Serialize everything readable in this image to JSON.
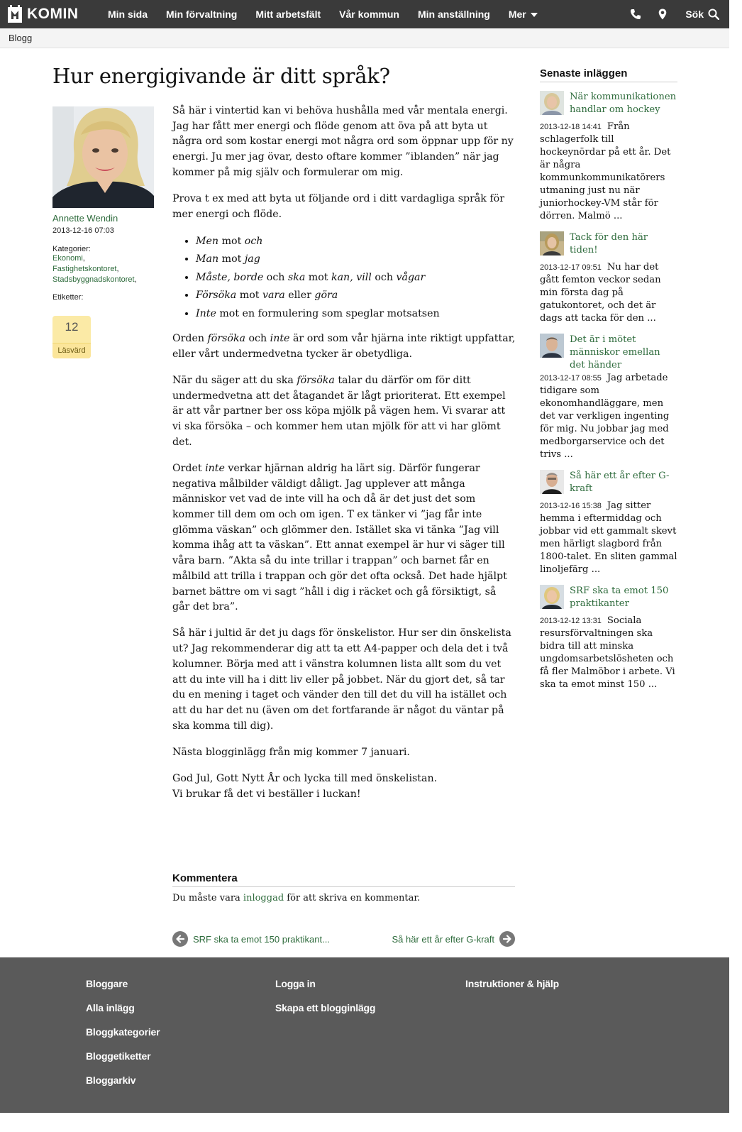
{
  "header": {
    "logo_text": "KOMIN",
    "nav": [
      "Min sida",
      "Min förvaltning",
      "Mitt arbetsfält",
      "Vår kommun",
      "Min anställning"
    ],
    "more_label": "Mer",
    "search_label": "Sök",
    "icons": [
      "phone-icon",
      "location-pin-icon",
      "search-icon"
    ]
  },
  "breadcrumb": "Blogg",
  "post": {
    "title": "Hur energigivande är ditt språk?",
    "author": "Annette Wendin",
    "date": "2013-12-16 07:03",
    "categories_label": "Kategorier:",
    "categories": [
      "Ekonomi",
      "Fastighetskontoret",
      "Stadsbyggnadskontoret"
    ],
    "tags_label": "Etiketter:",
    "worth_count": "12",
    "worth_label": "Läsvärd",
    "p1": "Så här i vintertid kan vi behöva hushålla med vår mentala energi. Jag har fått mer energi och flöde genom att öva på att byta ut några ord som kostar energi mot några ord som öppnar upp för ny energi. Ju mer jag övar, desto oftare kommer ”iblanden” när jag kommer på mig själv och formulerar om mig.",
    "p2": "Prova t ex med att byta ut följande ord i ditt vardagliga språk för mer energi och flöde.",
    "list": [
      {
        "a": "Men",
        "mid": " mot ",
        "b": "och",
        "c": "",
        "d": ""
      },
      {
        "a": "Man",
        "mid": " mot ",
        "b": "jag",
        "c": "",
        "d": ""
      },
      {
        "a": "Måste, borde",
        "mid": " och ",
        "b": "ska",
        "c": " mot ",
        "d": "kan, vill"
      },
      {
        "a": "Försöka",
        "mid": " mot ",
        "b": "vara",
        "c": " eller ",
        "d": "göra"
      },
      {
        "a": "Inte",
        "mid": " mot en formulering som speglar motsatsen",
        "b": "",
        "c": "",
        "d": ""
      }
    ],
    "list3_tail_mid": " och ",
    "list3_tail": "vågar",
    "p3_a": "Orden ",
    "p3_b": "försöka",
    "p3_c": " och ",
    "p3_d": "inte",
    "p3_e": " är ord som vår hjärna inte riktigt uppfattar, eller vårt undermedvetna tycker är obetydliga.",
    "p4_a": "När du säger att du ska ",
    "p4_b": "försöka",
    "p4_c": " talar du därför om för ditt undermedvetna att det åtagandet är lågt prioriterat. Ett exempel är att vår partner ber oss köpa mjölk på vägen hem. Vi svarar att vi ska försöka – och kommer hem utan mjölk för att vi har glömt det.",
    "p5_a": "Ordet ",
    "p5_b": "inte",
    "p5_c": " verkar hjärnan aldrig ha lärt sig. Därför fungerar negativa målbilder väldigt dåligt. Jag upplever att många människor vet vad de inte vill ha och då är det just det som kommer till dem om och om igen. T ex tänker vi ”jag får inte glömma väskan” och glömmer den. Istället ska vi tänka ”Jag vill komma ihåg att ta väskan”. Ett annat exempel är hur vi säger till våra barn. ”Akta så du inte trillar i trappan” och barnet får en målbild att trilla i trappan och gör det ofta också. Det hade hjälpt barnet bättre om vi sagt ”håll i dig i räcket och gå försiktigt, så går det bra”.",
    "p6": "Så här i jultid är det ju dags för önskelistor. Hur ser din önskelista ut? Jag rekommenderar dig att ta ett A4-papper och dela det i två kolumner. Börja med att i vänstra kolumnen lista allt som du vet att du inte vill ha i ditt liv eller på jobbet. När du gjort det, så tar du en mening i taget och vänder den till det du vill ha istället och att du har det nu (även om det fortfarande är något du väntar på ska komma till dig).",
    "p7": "Nästa blogginlägg  från mig kommer 7 januari.",
    "p8_1": "God Jul, Gott Nytt År och lycka till med önskelistan.",
    "p8_2": "Vi brukar få det vi beställer i luckan!"
  },
  "comment": {
    "heading": "Kommentera",
    "text_before": "Du måste vara ",
    "link": "inloggad",
    "text_after": " för att skriva en kommentar."
  },
  "pager": {
    "prev": "SRF ska ta emot 150 praktikant...",
    "next": "Så här ett år efter G-kraft"
  },
  "sidebar": {
    "heading": "Senaste inläggen",
    "posts": [
      {
        "title": "När kommunikationen handlar om hockey",
        "date": "2013-12-18 14:41",
        "excerpt": "Från schlagerfolk till hockeynördar på ett år. Det är några kommunkommunikatörers utmaning just nu när juniorhockey-VM står för dörren. Malmö ..."
      },
      {
        "title": "Tack för den här tiden!",
        "date": "2013-12-17 09:51",
        "excerpt": "Nu har det gått femton veckor sedan min första dag på gatukontoret, och det är dags att tacka för den ..."
      },
      {
        "title": "Det är i mötet människor emellan det händer",
        "date": "2013-12-17 08:55",
        "excerpt": "Jag arbetade tidigare som ekonomhandläggare, men det var verkligen ingenting för mig. Nu jobbar jag med medborgarservice och det trivs ..."
      },
      {
        "title": "Så här ett år efter G-kraft",
        "date": "2013-12-16 15:38",
        "excerpt": "Jag sitter hemma i eftermiddag och jobbar vid ett gammalt skevt men härligt slagbord från 1800-talet. En sliten gammal linoljefärg ..."
      },
      {
        "title": "SRF ska ta emot 150 praktikanter",
        "date": "2013-12-12 13:31",
        "excerpt": "Sociala resursförvaltningen ska bidra till att minska ungdomsarbetslösheten och få fler Malmöbor i arbete. Vi ska ta emot minst 150 ..."
      }
    ]
  },
  "footer": {
    "col1": [
      "Bloggare",
      "Alla inlägg",
      "Bloggkategorier",
      "Bloggetiketter",
      "Bloggarkiv"
    ],
    "col2": [
      "Logga in",
      "Skapa ett blogginlägg"
    ],
    "col3": [
      "Instruktioner & hjälp"
    ]
  }
}
